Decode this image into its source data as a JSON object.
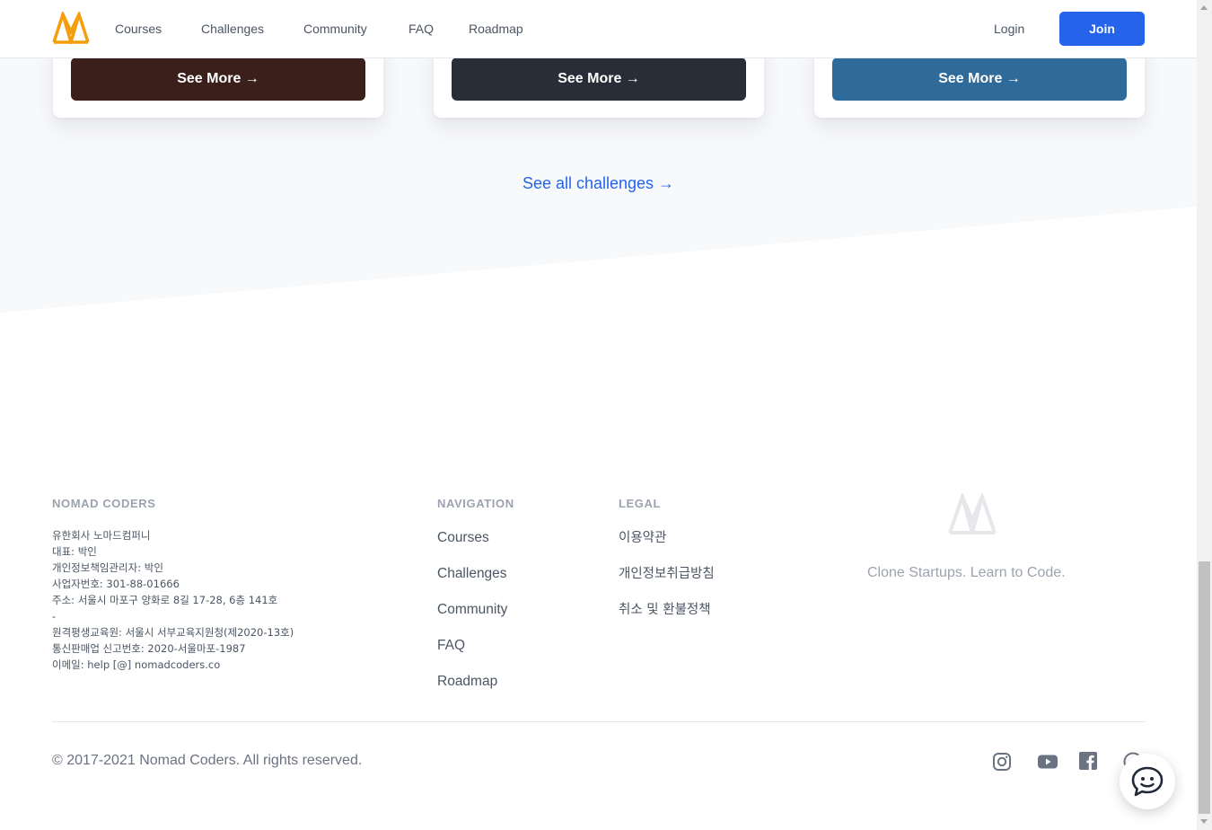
{
  "header": {
    "nav": [
      "Courses",
      "Challenges",
      "Community",
      "FAQ",
      "Roadmap"
    ],
    "login_label": "Login",
    "join_label": "Join"
  },
  "challenges": {
    "cards": [
      {
        "button_label": "See More →",
        "color": "#3a1f1b"
      },
      {
        "button_label": "See More →",
        "color": "#282d37"
      },
      {
        "button_label": "See More →",
        "color": "#2f6b9a"
      }
    ],
    "see_all_label": "See all challenges →"
  },
  "footer": {
    "company": {
      "heading": "NOMAD CODERS",
      "lines": [
        "유한회사 노마드컴퍼니",
        "대표: 박인",
        "개인정보책임관리자: 박인",
        "사업자번호: 301-88-01666",
        "주소: 서울시 마포구 양화로 8길 17-28, 6층 141호",
        "-",
        "원격평생교육원: 서울시 서부교육지원청(제2020-13호)",
        "통신판매업 신고번호: 2020-서울마포-1987",
        "이메일: help [@] nomadcoders.co"
      ]
    },
    "navigation": {
      "heading": "NAVIGATION",
      "items": [
        "Courses",
        "Challenges",
        "Community",
        "FAQ",
        "Roadmap"
      ]
    },
    "legal": {
      "heading": "LEGAL",
      "items": [
        "이용약관",
        "개인정보취급방침",
        "취소 및 환불정책"
      ]
    },
    "slogan": "Clone Startups. Learn to Code.",
    "copyright": "© 2017-2021 Nomad Coders. All rights reserved.",
    "social_icons": [
      "instagram-icon",
      "youtube-icon",
      "facebook-icon",
      "github-icon"
    ]
  },
  "colors": {
    "brand": "#f59e0b",
    "primary": "#2563eb"
  }
}
